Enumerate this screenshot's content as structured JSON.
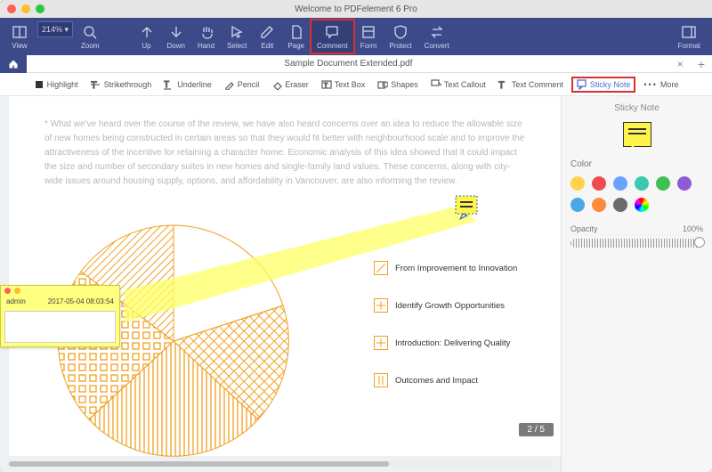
{
  "window": {
    "title": "Welcome to PDFelement 6 Pro"
  },
  "toolbar": {
    "zoom_value": "214% ▾",
    "view": "View",
    "zoom": "Zoom",
    "up": "Up",
    "down": "Down",
    "hand": "Hand",
    "select": "Select",
    "edit": "Edit",
    "page": "Page",
    "comment": "Comment",
    "form": "Form",
    "protect": "Protect",
    "convert": "Convert",
    "format": "Format"
  },
  "doc_tab": {
    "filename": "Sample Document Extended.pdf"
  },
  "subtoolbar": {
    "highlight": "Highlight",
    "strikethrough": "Strikethrough",
    "underline": "Underline",
    "pencil": "Pencil",
    "eraser": "Eraser",
    "textbox": "Text Box",
    "shapes": "Shapes",
    "textcallout": "Text Callout",
    "textcomment": "Text Comment",
    "stickynote": "Sticky Note",
    "more": "More"
  },
  "document": {
    "paragraph": "* What we've heard over the course of the review, we have also heard concerns over an idea to reduce the allowable size of new homes being constructed in certain areas so that they would fit better with neighbourhood scale and to improve the attractiveness of the incentive for retaining a character home. Economic analysis of this idea showed that it could impact the size and number of secondary suites in new homes and single-family land values. These concerns, along with city-wide issues around housing supply, options, and affordability in Vancouver, are also informing the review.",
    "legend": [
      "From Improvement to Innovation",
      "Identify Growth Opportunities",
      "Introduction: Delivering Quality",
      "Outcomes and Impact"
    ],
    "page_indicator": "2 / 5"
  },
  "sticky_note": {
    "author": "admin",
    "timestamp": "2017-05-04 08:03:54"
  },
  "sidepanel": {
    "title": "Sticky Note",
    "color_label": "Color",
    "opacity_label": "Opacity",
    "opacity_value": "100%",
    "swatches": [
      "#ffd24a",
      "#ef4d4d",
      "#6aa3ff",
      "#38c9b0",
      "#3fbf55",
      "#8e5bd6",
      "#4aa8e8",
      "#ff8a3c",
      "#6b6b6b",
      "conic"
    ]
  },
  "chart_data": {
    "type": "pie",
    "title": "",
    "categories": [
      "From Improvement to Innovation",
      "Identify Growth Opportunities",
      "Introduction: Delivering Quality",
      "Outcomes and Impact"
    ],
    "values": [
      30,
      20,
      25,
      25
    ],
    "colors_note": "orange outline patterns: diagonal-stripes, grid-squares, vertical-stripes, diamond-crosshatch"
  }
}
